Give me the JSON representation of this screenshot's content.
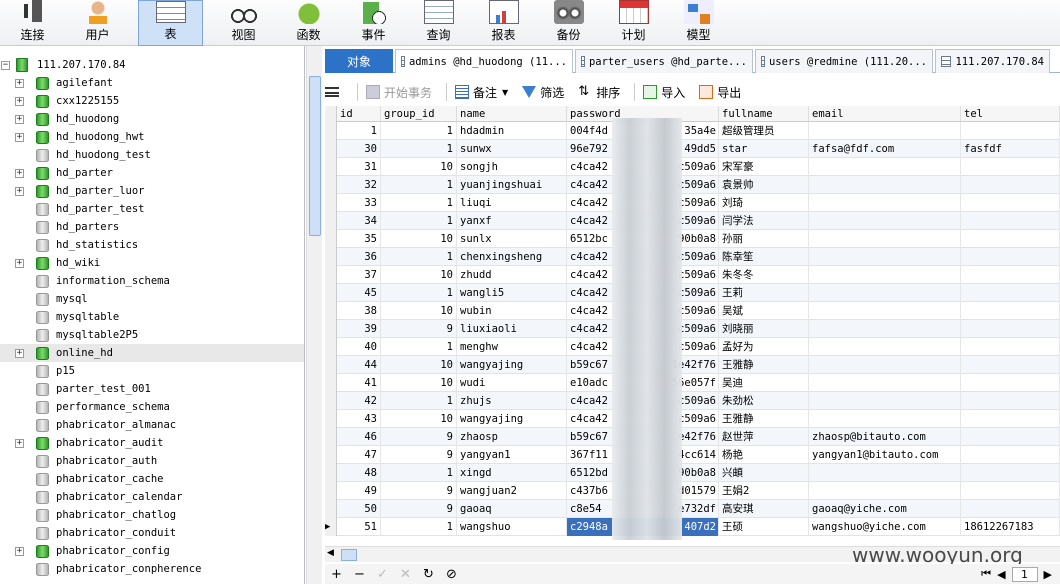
{
  "toolbar": {
    "items": [
      {
        "label": "连接",
        "icon": "plug-icon"
      },
      {
        "label": "用户",
        "icon": "user-icon"
      },
      {
        "label": "表",
        "icon": "table-icon",
        "active": true
      },
      {
        "label": "视图",
        "icon": "glasses-icon"
      },
      {
        "label": "函数",
        "icon": "function-icon"
      },
      {
        "label": "事件",
        "icon": "event-clock-icon"
      },
      {
        "label": "查询",
        "icon": "query-table-icon"
      },
      {
        "label": "报表",
        "icon": "report-icon"
      },
      {
        "label": "备份",
        "icon": "backup-tape-icon"
      },
      {
        "label": "计划",
        "icon": "calendar-icon"
      },
      {
        "label": "模型",
        "icon": "model-icon"
      }
    ]
  },
  "tree": {
    "server": "111.207.170.84",
    "databases": [
      {
        "name": "agilefant",
        "expandable": true,
        "open": true
      },
      {
        "name": "cxx1225155",
        "expandable": true,
        "open": true
      },
      {
        "name": "hd_huodong",
        "expandable": true,
        "open": true
      },
      {
        "name": "hd_huodong_hwt",
        "expandable": true,
        "open": true
      },
      {
        "name": "hd_huodong_test",
        "expandable": false,
        "open": false
      },
      {
        "name": "hd_parter",
        "expandable": true,
        "open": true
      },
      {
        "name": "hd_parter_luor",
        "expandable": true,
        "open": true
      },
      {
        "name": "hd_parter_test",
        "expandable": false,
        "open": false
      },
      {
        "name": "hd_parters",
        "expandable": false,
        "open": false
      },
      {
        "name": "hd_statistics",
        "expandable": false,
        "open": false
      },
      {
        "name": "hd_wiki",
        "expandable": true,
        "open": true
      },
      {
        "name": "information_schema",
        "expandable": false,
        "open": false
      },
      {
        "name": "mysql",
        "expandable": false,
        "open": false
      },
      {
        "name": "mysqltable",
        "expandable": false,
        "open": false
      },
      {
        "name": "mysqltable2P5",
        "expandable": false,
        "open": false
      },
      {
        "name": "online_hd",
        "expandable": true,
        "open": true,
        "selected": true
      },
      {
        "name": "p15",
        "expandable": false,
        "open": false
      },
      {
        "name": "parter_test_001",
        "expandable": false,
        "open": false
      },
      {
        "name": "performance_schema",
        "expandable": false,
        "open": false
      },
      {
        "name": "phabricator_almanac",
        "expandable": false,
        "open": false
      },
      {
        "name": "phabricator_audit",
        "expandable": true,
        "open": true
      },
      {
        "name": "phabricator_auth",
        "expandable": false,
        "open": false
      },
      {
        "name": "phabricator_cache",
        "expandable": false,
        "open": false
      },
      {
        "name": "phabricator_calendar",
        "expandable": false,
        "open": false
      },
      {
        "name": "phabricator_chatlog",
        "expandable": false,
        "open": false
      },
      {
        "name": "phabricator_conduit",
        "expandable": false,
        "open": false
      },
      {
        "name": "phabricator_config",
        "expandable": true,
        "open": true
      },
      {
        "name": "phabricator_conpherence",
        "expandable": false,
        "open": false
      }
    ]
  },
  "tabs": [
    {
      "label": "对象",
      "kind": "obj"
    },
    {
      "label": "admins @hd_huodong (11...",
      "kind": "table",
      "active": true
    },
    {
      "label": "parter_users @hd_parte...",
      "kind": "table"
    },
    {
      "label": "users @redmine (111.20...",
      "kind": "table"
    },
    {
      "label": "111.207.170.84",
      "kind": "console"
    }
  ],
  "subtoolbar": {
    "begin_tx": "开始事务",
    "memo": "备注",
    "filter": "筛选",
    "sort": "排序",
    "import": "导入",
    "export": "导出"
  },
  "columns": [
    "id",
    "group_id",
    "name",
    "password",
    "fullname",
    "email",
    "tel"
  ],
  "rows": [
    {
      "id": "1",
      "group_id": "1",
      "name": "hdadmin",
      "password": "004f4d",
      "pw_tail": "35a4e",
      "fullname": "超级管理员",
      "email": "",
      "tel": ""
    },
    {
      "id": "30",
      "group_id": "1",
      "name": "sunwx",
      "password": "96e792",
      "pw_tail": "49dd5",
      "fullname": "star",
      "email": "fafsa@fdf.com",
      "tel": "fasfdf"
    },
    {
      "id": "31",
      "group_id": "10",
      "name": "songjh",
      "password": "c4ca42",
      "pw_tail": "c509a6",
      "fullname": "宋军豪",
      "email": "",
      "tel": ""
    },
    {
      "id": "32",
      "group_id": "1",
      "name": "yuanjingshuai",
      "password": "c4ca42",
      "pw_tail": "c509a6",
      "fullname": "袁景帅",
      "email": "",
      "tel": ""
    },
    {
      "id": "33",
      "group_id": "1",
      "name": "liuqi",
      "password": "c4ca42",
      "pw_tail": "c509a6",
      "fullname": "刘琦",
      "email": "",
      "tel": ""
    },
    {
      "id": "34",
      "group_id": "1",
      "name": "yanxf",
      "password": "c4ca42",
      "pw_tail": "c509a6",
      "fullname": "闫学法",
      "email": "",
      "tel": ""
    },
    {
      "id": "35",
      "group_id": "10",
      "name": "sunlx",
      "password": "6512bc",
      "pw_tail": "90b0a8",
      "fullname": "孙丽",
      "email": "",
      "tel": ""
    },
    {
      "id": "36",
      "group_id": "1",
      "name": "chenxingsheng",
      "password": "c4ca42",
      "pw_tail": "c509a6",
      "fullname": "陈幸笙",
      "email": "",
      "tel": ""
    },
    {
      "id": "37",
      "group_id": "10",
      "name": "zhudd",
      "password": "c4ca42",
      "pw_tail": "c509a6",
      "fullname": "朱冬冬",
      "email": "",
      "tel": ""
    },
    {
      "id": "45",
      "group_id": "1",
      "name": "wangli5",
      "password": "c4ca42",
      "pw_tail": "c509a6",
      "fullname": "王莉",
      "email": "",
      "tel": ""
    },
    {
      "id": "38",
      "group_id": "10",
      "name": "wubin",
      "password": "c4ca42",
      "pw_tail": "c509a6",
      "fullname": "吴斌",
      "email": "",
      "tel": ""
    },
    {
      "id": "39",
      "group_id": "9",
      "name": "liuxiaoli",
      "password": "c4ca42",
      "pw_tail": "c509a6",
      "fullname": "刘晓丽",
      "email": "",
      "tel": ""
    },
    {
      "id": "40",
      "group_id": "1",
      "name": "menghw",
      "password": "c4ca42",
      "pw_tail": "c509a6",
      "fullname": "孟好为",
      "email": "",
      "tel": ""
    },
    {
      "id": "44",
      "group_id": "10",
      "name": "wangyajing",
      "password": "b59c67",
      "pw_tail": "1e42f76",
      "fullname": "王雅静",
      "email": "",
      "tel": ""
    },
    {
      "id": "41",
      "group_id": "10",
      "name": "wudi",
      "password": "e10adc",
      "pw_tail": "56e057f",
      "fullname": "吴迪",
      "email": "",
      "tel": ""
    },
    {
      "id": "42",
      "group_id": "1",
      "name": "zhujs",
      "password": "c4ca42",
      "pw_tail": "c509a6",
      "fullname": "朱劲松",
      "email": "",
      "tel": ""
    },
    {
      "id": "43",
      "group_id": "10",
      "name": "wangyajing",
      "password": "c4ca42",
      "pw_tail": "c509a6",
      "fullname": "王雅静",
      "email": "",
      "tel": ""
    },
    {
      "id": "46",
      "group_id": "9",
      "name": "zhaosp",
      "password": "b59c67",
      "pw_tail": "e42f76",
      "fullname": "赵世萍",
      "email": "zhaosp@bitauto.com",
      "tel": ""
    },
    {
      "id": "47",
      "group_id": "9",
      "name": "yangyan1",
      "password": "367f11",
      "pw_tail": "4cc614",
      "fullname": "杨艳",
      "email": "yangyan1@bitauto.com",
      "tel": ""
    },
    {
      "id": "48",
      "group_id": "1",
      "name": "xingd",
      "password": "6512bd",
      "pw_tail": "90b0a8",
      "fullname": "兴頔",
      "email": "",
      "tel": ""
    },
    {
      "id": "49",
      "group_id": "9",
      "name": "wangjuan2",
      "password": "c437b6",
      "pw_tail": "d01579",
      "fullname": "王娟2",
      "email": "",
      "tel": ""
    },
    {
      "id": "50",
      "group_id": "9",
      "name": "gaoaq",
      "password": "c8e54",
      "pw_tail": "e732df",
      "fullname": "高安琪",
      "email": "gaoaq@yiche.com",
      "tel": ""
    },
    {
      "id": "51",
      "group_id": "1",
      "name": "wangshuo",
      "password": "c2948a",
      "pw_tail": "407d2",
      "fullname": "王硕",
      "email": "wangshuo@yiche.com",
      "tel": "18612267183",
      "current": true
    }
  ],
  "bottom": {
    "add": "+",
    "remove": "−",
    "apply": "✓",
    "cancel": "✕",
    "refresh": "↻",
    "stop": "⊘",
    "page": "1"
  },
  "watermark": "www.wooyun.org",
  "colors": {
    "accent": "#2c72c7",
    "selection": "#3a6fbd",
    "db_on": "#2d9a2d"
  }
}
